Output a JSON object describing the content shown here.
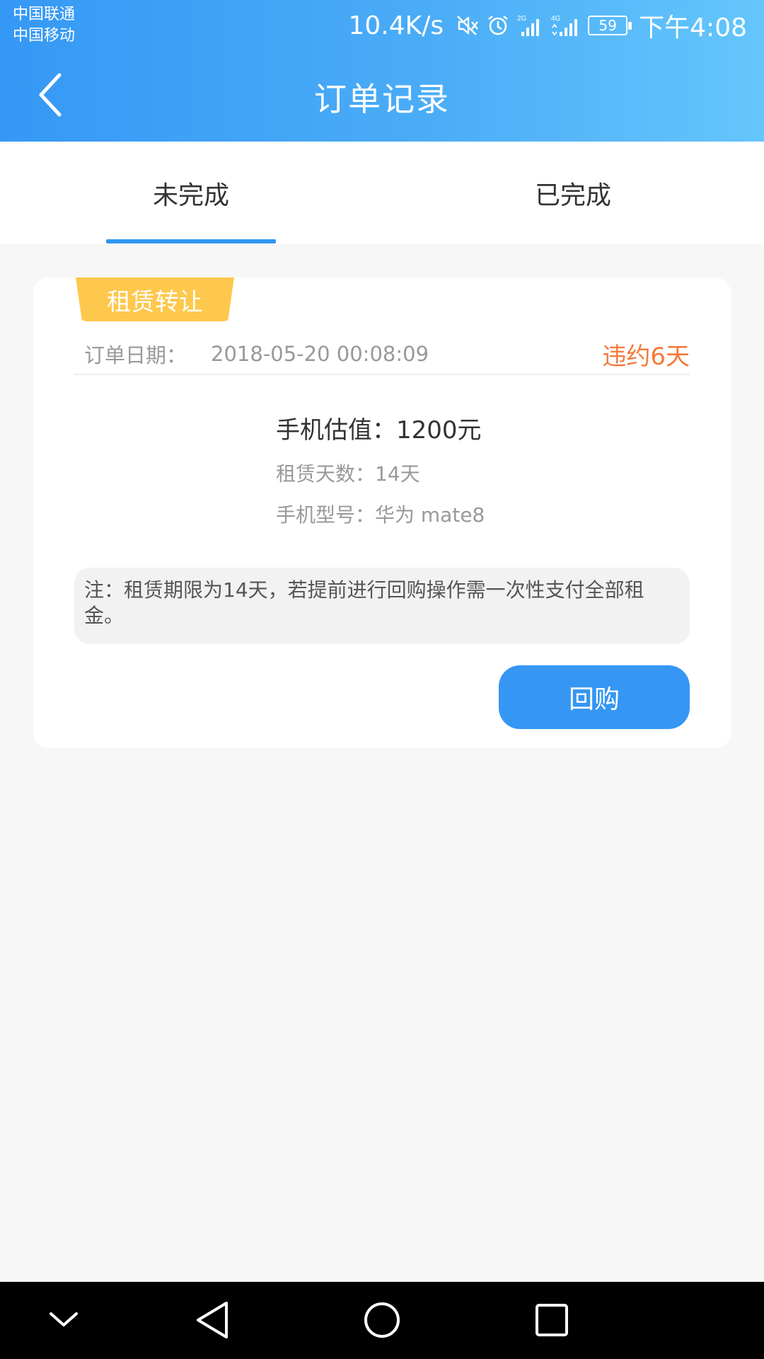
{
  "status_bar": {
    "carrier1": "中国联通",
    "carrier2": "中国移动",
    "speed": "10.4K/s",
    "signal1_label": "2G",
    "signal2_label": "4G",
    "battery": "59",
    "time": "下午4:08"
  },
  "header": {
    "title": "订单记录"
  },
  "tabs": [
    {
      "label": "未完成",
      "active": true
    },
    {
      "label": "已完成",
      "active": false
    }
  ],
  "order": {
    "tag": "租赁转让",
    "date_label": "订单日期：",
    "date": "2018-05-20 00:08:09",
    "overdue": "违约6天",
    "valuation": "手机估值：1200元",
    "lease_days": "租赁天数：14天",
    "model": "手机型号：华为 mate8",
    "note": "注：租赁期限为14天，若提前进行回购操作需一次性支付全部租金。",
    "button": "回购"
  },
  "colors": {
    "accent": "#3597f3",
    "tag": "#fec84c",
    "overdue": "#f47a3a"
  }
}
